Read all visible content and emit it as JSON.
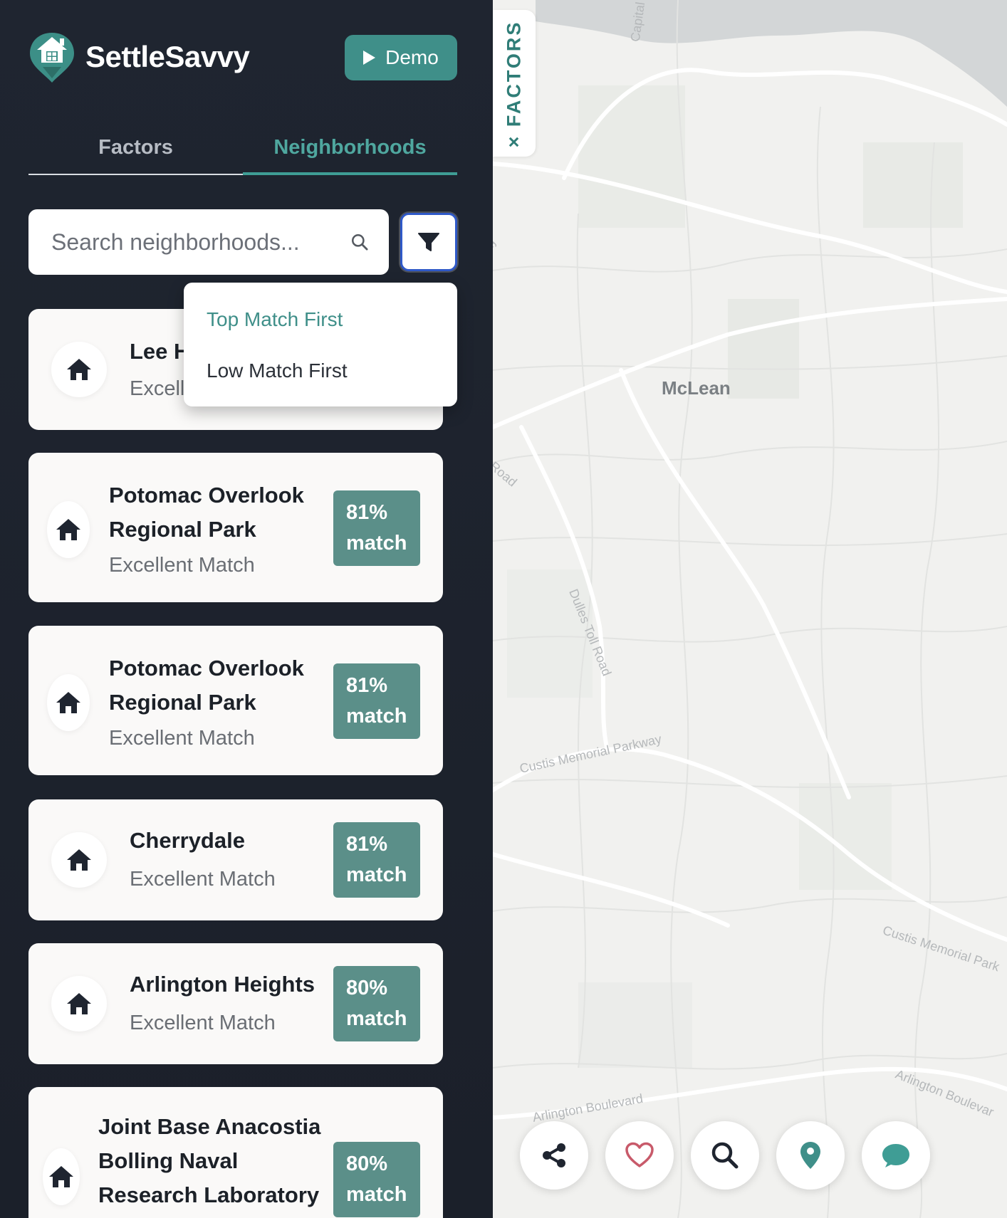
{
  "app": {
    "title": "SettleSavvy",
    "demo_label": "Demo"
  },
  "tabs": [
    {
      "label": "Factors",
      "active": false
    },
    {
      "label": "Neighborhoods",
      "active": true
    }
  ],
  "search": {
    "placeholder": "Search neighborhoods...",
    "value": ""
  },
  "sort_menu": {
    "options": [
      {
        "label": "Top Match First",
        "selected": true
      },
      {
        "label": "Low Match First",
        "selected": false
      }
    ]
  },
  "neighborhoods": [
    {
      "name": "Lee H",
      "rating": "Excell"
    },
    {
      "name_lines": [
        "Potomac Overlook",
        "Regional Park"
      ],
      "rating": "Excellent Match",
      "match_pct": "81%",
      "match_word": "match"
    },
    {
      "name_lines": [
        "Potomac Overlook",
        "Regional Park"
      ],
      "rating": "Excellent Match",
      "match_pct": "81%",
      "match_word": "match"
    },
    {
      "name": "Cherrydale",
      "rating": "Excellent Match",
      "match_pct": "81%",
      "match_word": "match"
    },
    {
      "name": "Arlington Heights",
      "rating": "Excellent Match",
      "match_pct": "80%",
      "match_word": "match"
    },
    {
      "name_lines": [
        "Joint Base Anacostia",
        "Bolling Naval",
        "Research Laboratory"
      ],
      "match_pct": "80%",
      "match_word": "match"
    }
  ],
  "map": {
    "factors_toggle": "× FACTORS",
    "city": "McLean",
    "road_labels": [
      "Capital",
      "tway",
      "Road",
      "Dulles Toll Road",
      "Custis Memorial Parkway",
      "Custis Memorial Park",
      "Arlington Boulevard",
      "Arlington Boulevar"
    ]
  },
  "toolbar": {
    "buttons": [
      {
        "icon": "share-icon"
      },
      {
        "icon": "heart-icon"
      },
      {
        "icon": "search-icon"
      },
      {
        "icon": "location-pin-icon"
      },
      {
        "icon": "chat-icon"
      }
    ]
  },
  "colors": {
    "sidebar_bg": "#1f2530",
    "accent": "#3f8f89",
    "badge": "#5b8f89",
    "active_tab": "#4fa79f",
    "filter_border": "#2f59c8",
    "heart": "#c85a6a"
  }
}
